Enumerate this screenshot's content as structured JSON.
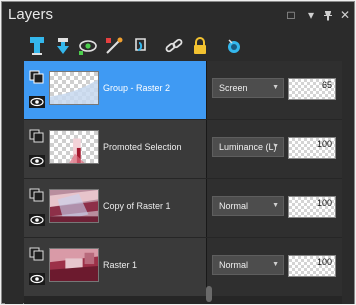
{
  "panel": {
    "title": "Layers",
    "buttons": {
      "float": "□",
      "menu": "▾",
      "close": "✕"
    }
  },
  "toolbar": {
    "icons": [
      "new-raster-layer-icon",
      "new-vector-layer-icon",
      "new-mask-layer-icon",
      "adjustment-layer-icon",
      "new-group-icon",
      "link-icon",
      "lock-icon",
      "visibility-icon"
    ]
  },
  "layers": [
    {
      "name": "Group - Raster 2",
      "blend_mode": "Screen",
      "opacity": "65",
      "selected": true
    },
    {
      "name": "Promoted Selection",
      "blend_mode": "Luminance (L)",
      "opacity": "100",
      "selected": false
    },
    {
      "name": "Copy of Raster 1",
      "blend_mode": "Normal",
      "opacity": "100",
      "selected": false
    },
    {
      "name": "Raster 1",
      "blend_mode": "Normal",
      "opacity": "100",
      "selected": false
    }
  ],
  "colors": {
    "panel_bg": "#2b2b2b",
    "selected_row": "#3f9af3",
    "row_bg": "#3a3a3a"
  }
}
